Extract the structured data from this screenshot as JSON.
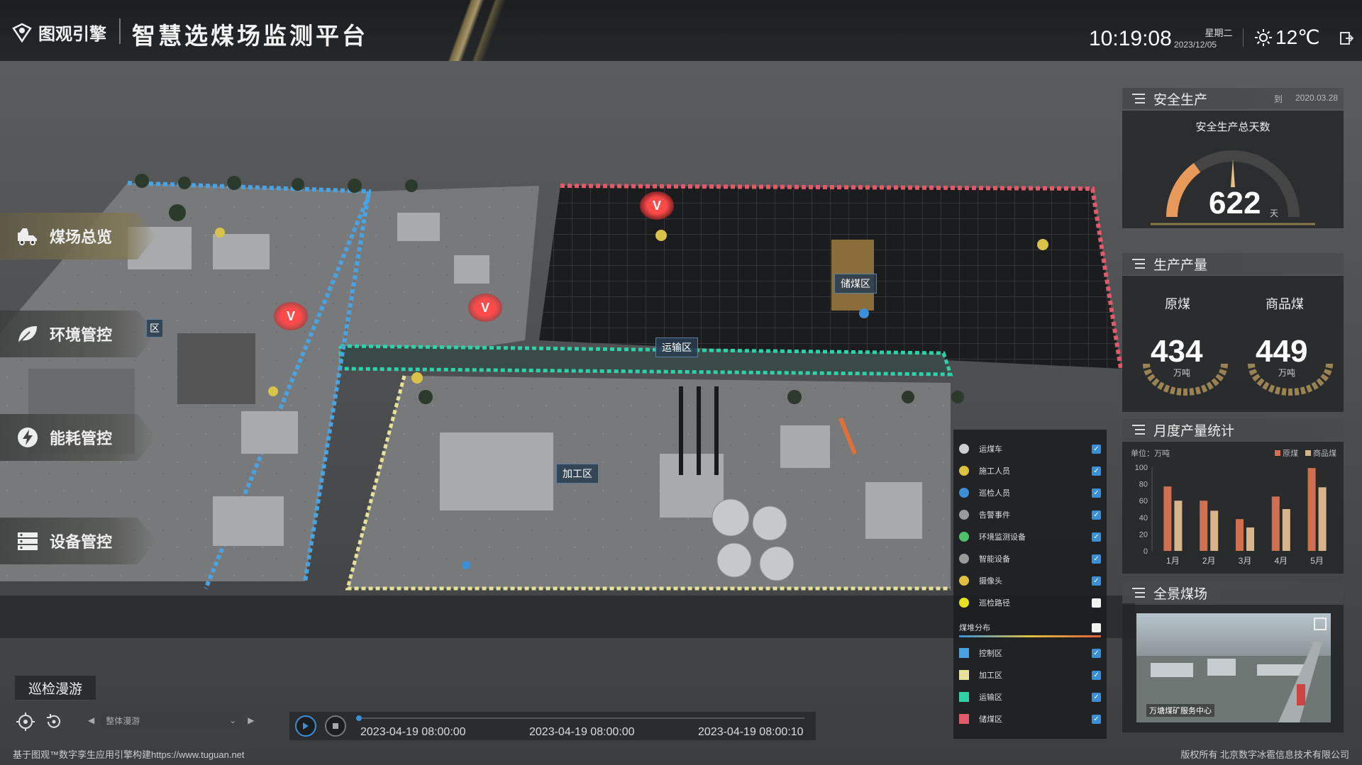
{
  "header": {
    "logo_text": "图观引擎",
    "app_title": "智慧选煤场监测平台",
    "time": "10:19:08",
    "weekday": "星期二",
    "date": "2023/12/05",
    "temperature": "12℃"
  },
  "nav": {
    "items": [
      {
        "label": "煤场总览",
        "icon": "truck-icon",
        "active": true
      },
      {
        "label": "环境管控",
        "icon": "leaf-icon",
        "active": false
      },
      {
        "label": "能耗管控",
        "icon": "energy-icon",
        "active": false
      },
      {
        "label": "设备管控",
        "icon": "equipment-icon",
        "active": false
      }
    ]
  },
  "scene": {
    "labels": {
      "storage": "储煤区",
      "transport": "运输区",
      "processing": "加工区",
      "partial_left": "区"
    },
    "alarm_symbol": "V"
  },
  "safety": {
    "title": "安全生产",
    "date_prefix": "到",
    "date": "2020.03.28",
    "gauge_title": "安全生产总天数",
    "days": "622",
    "unit": "天",
    "gauge_fraction": 0.3
  },
  "output": {
    "title": "生产产量",
    "raw_label": "原煤",
    "raw_value": "434",
    "raw_unit": "万吨",
    "product_label": "商品煤",
    "product_value": "449",
    "product_unit": "万吨"
  },
  "monthly": {
    "title": "月度产量统计",
    "unit_label": "单位：万吨",
    "legend_raw": "原煤",
    "legend_product": "商品煤",
    "raw_color": "#d07050",
    "product_color": "#d8b48a"
  },
  "chart_data": {
    "type": "bar",
    "categories": [
      "1月",
      "2月",
      "3月",
      "4月",
      "5月"
    ],
    "series": [
      {
        "name": "原煤",
        "values": [
          77,
          60,
          38,
          65,
          99
        ]
      },
      {
        "name": "商品煤",
        "values": [
          60,
          48,
          28,
          50,
          76
        ]
      }
    ],
    "yticks": [
      "100",
      "80",
      "60",
      "40",
      "20",
      "0"
    ],
    "ylim": [
      0,
      100
    ],
    "ylabel": "单位：万吨"
  },
  "panorama": {
    "title": "全景煤场",
    "caption": "万塘煤矿服务中心"
  },
  "legend": {
    "items": [
      {
        "label": "运煤车",
        "color": "#cfcfcf",
        "checked": true
      },
      {
        "label": "施工人员",
        "color": "#e0c040",
        "checked": true
      },
      {
        "label": "巡检人员",
        "color": "#3b8fd6",
        "checked": true
      },
      {
        "label": "告警事件",
        "color": "#9a9a9a",
        "checked": true
      },
      {
        "label": "环境监测设备",
        "color": "#4fc06a",
        "checked": true
      },
      {
        "label": "智能设备",
        "color": "#9a9a9a",
        "checked": true
      },
      {
        "label": "摄像头",
        "color": "#e0c040",
        "checked": true
      },
      {
        "label": "巡检路径",
        "color": "#e8e020",
        "checked": false
      }
    ],
    "heat_label": "煤堆分布",
    "heat_checked": false,
    "zones": [
      {
        "label": "控制区",
        "color": "#4aa3e0",
        "checked": true
      },
      {
        "label": "加工区",
        "color": "#e6e29a",
        "checked": true
      },
      {
        "label": "运输区",
        "color": "#2fd1a8",
        "checked": true
      },
      {
        "label": "储煤区",
        "color": "#e05a6a",
        "checked": true
      }
    ]
  },
  "bottom": {
    "tour_label": "巡检漫游",
    "view_placeholder": "整体漫游",
    "time_start": "2023-04-19 08:00:00",
    "time_mid": "2023-04-19 08:00:00",
    "time_end": "2023-04-19 08:00:10",
    "footer_left": "基于图观™数字孪生应用引擎构建https://www.tuguan.net",
    "footer_right": "版权所有 北京数字冰雹信息技术有限公司"
  }
}
